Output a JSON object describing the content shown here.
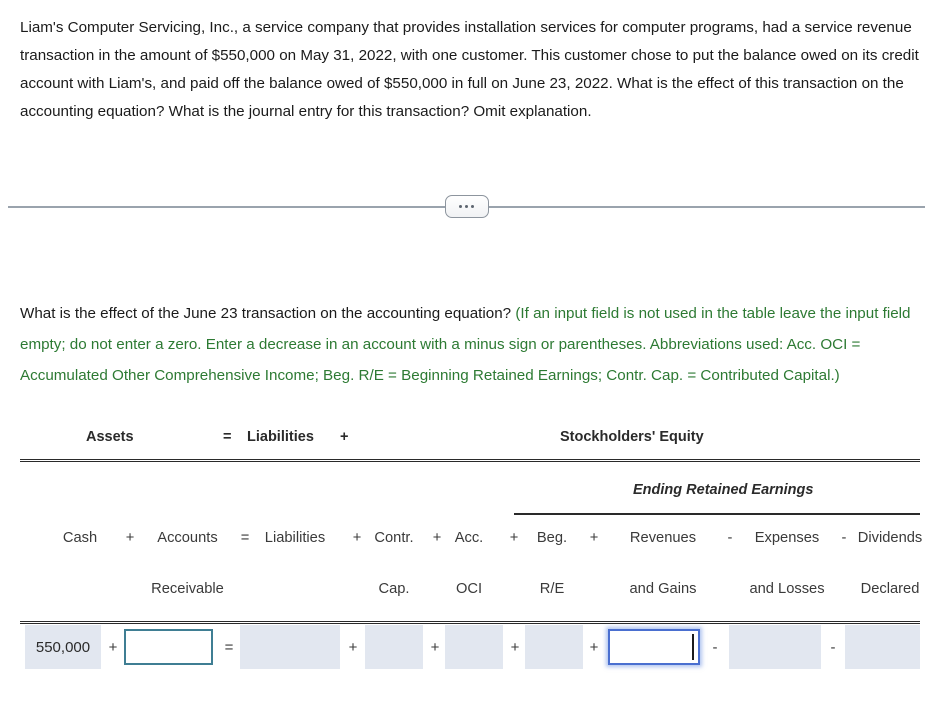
{
  "problem": {
    "statement": "Liam's Computer Servicing, Inc., a service company that provides installation services for computer programs, had a service revenue transaction in the amount of $550,000 on May 31, 2022, with one customer. This customer chose to put the balance owed on its credit account with Liam's, and paid off the balance owed of $550,000 in full on June 23, 2022. What is the effect of this transaction on the accounting equation? What is the journal entry for this transaction? Omit explanation."
  },
  "divider": {
    "icon": "ellipsis-icon"
  },
  "instruction": {
    "question": "What is the effect of the June 23 transaction on the accounting equation?",
    "hint": "(If an input field is not used in the table leave the input field empty; do not enter a zero. Enter a decrease in an account with a minus sign or parentheses. Abbreviations used: Acc. OCI = Accumulated Other Comprehensive Income; Beg. R/E = Beginning Retained Earnings; Contr. Cap. = Contributed Capital.)",
    "hint_color": "#2d7a33"
  },
  "table": {
    "group_headers": {
      "assets": "Assets",
      "equals": "=",
      "liabilities": "Liabilities",
      "plus": "+",
      "stockholders_equity": "Stockholders' Equity",
      "ending_retained_earnings": "Ending Retained Earnings"
    },
    "columns": [
      {
        "line1": "Cash",
        "line2": ""
      },
      {
        "line1": "Accounts",
        "line2": "Receivable"
      },
      {
        "line1": "Liabilities",
        "line2": ""
      },
      {
        "line1": "Contr.",
        "line2": "Cap."
      },
      {
        "line1": "Acc.",
        "line2": "OCI"
      },
      {
        "line1": "Beg.",
        "line2": "R/E"
      },
      {
        "line1": "Revenues",
        "line2": "and Gains"
      },
      {
        "line1": "Expenses",
        "line2": "and Losses"
      },
      {
        "line1": "Dividends",
        "line2": "Declared"
      }
    ],
    "operators": [
      "+",
      "=",
      "+",
      "+",
      "+",
      "+",
      "-",
      "-"
    ],
    "row": {
      "cash": "550,000",
      "accounts_receivable_input": "",
      "liabilities": "",
      "contr_cap": "",
      "acc_oci": "",
      "beg_re": "",
      "revenues_and_gains_input": "",
      "expenses_and_losses": "",
      "dividends_declared": ""
    },
    "colors": {
      "cell_fill": "#e2e7f0",
      "input_border": "#3f7e93",
      "focused_input_border": "#4a6fd0"
    }
  }
}
